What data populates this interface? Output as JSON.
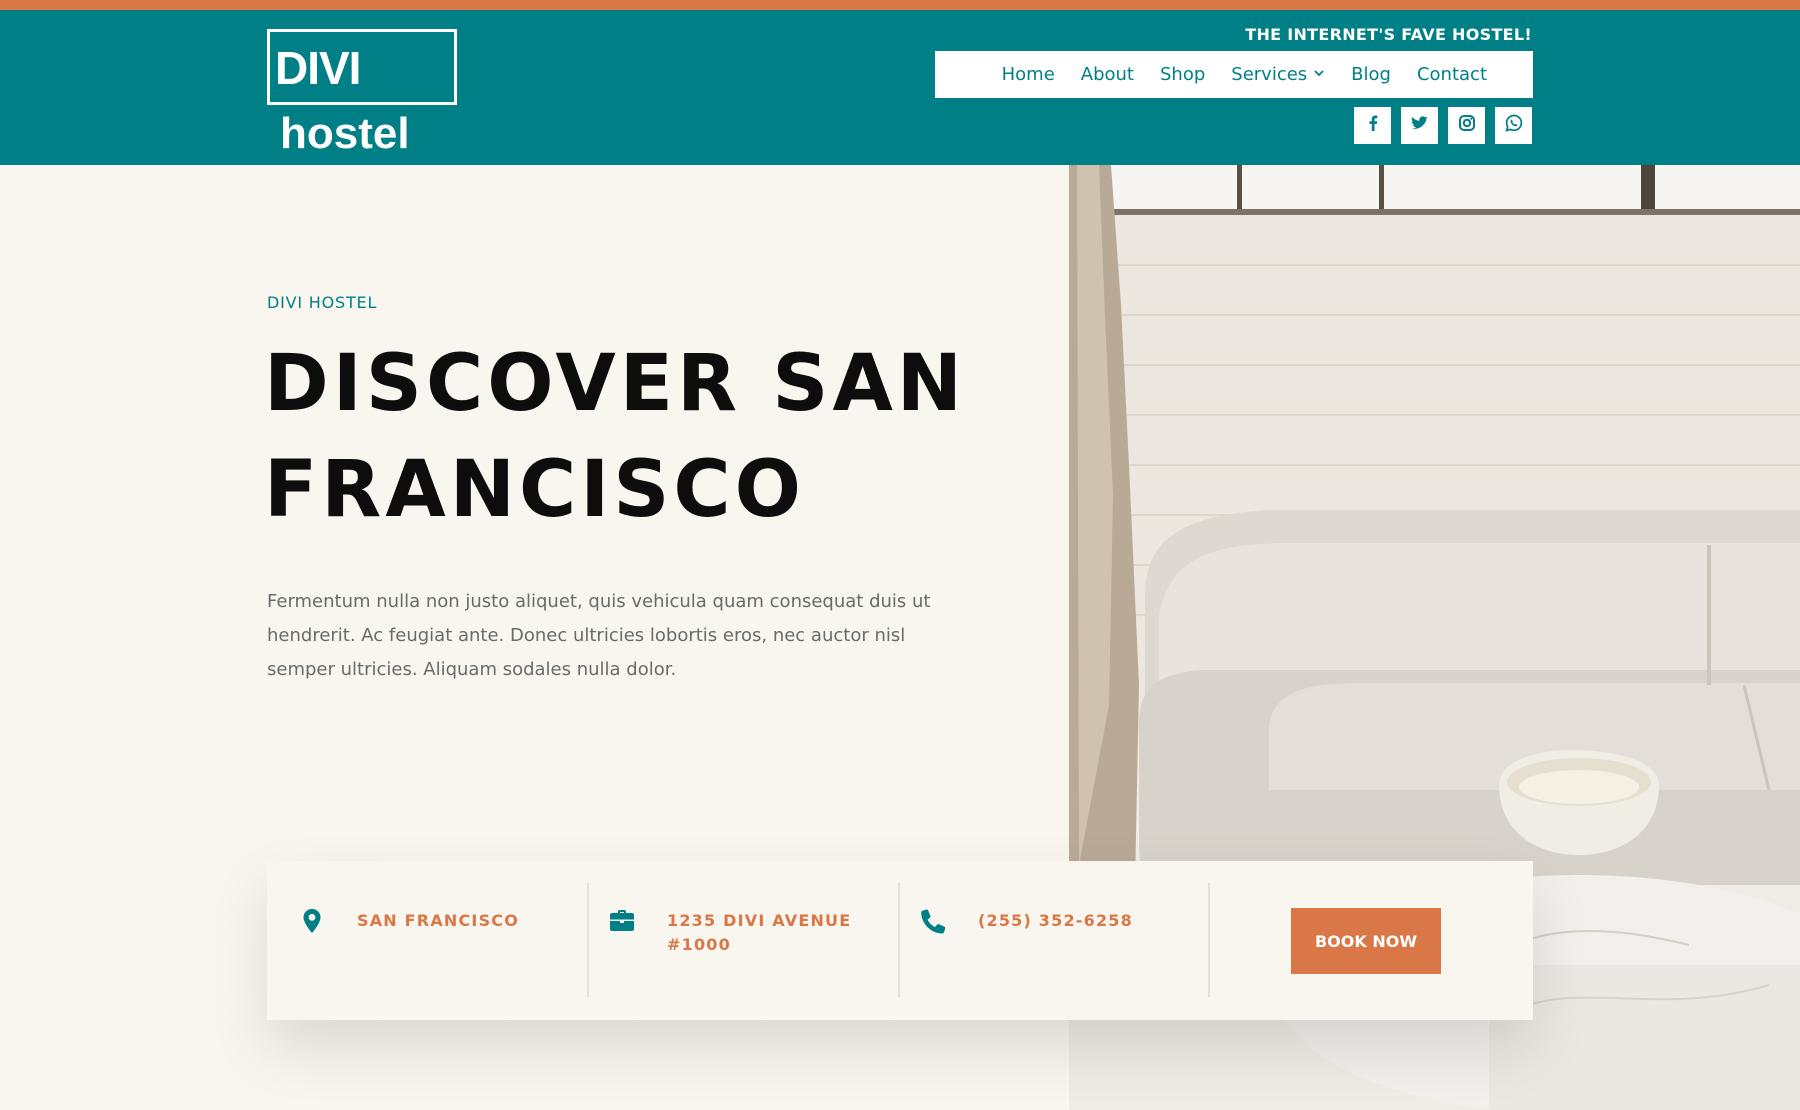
{
  "colors": {
    "teal": "#007f86",
    "orange": "#d97846",
    "cream": "#f9f6f0",
    "dark_text": "#0d0d0d",
    "body_text": "#6a6a6a"
  },
  "header": {
    "logo_top": "DIVI",
    "logo_bottom": "hostel",
    "tagline": "THE INTERNET'S FAVE HOSTEL!",
    "nav": [
      {
        "label": "Home"
      },
      {
        "label": "About"
      },
      {
        "label": "Shop"
      },
      {
        "label": "Services",
        "has_dropdown": true
      },
      {
        "label": "Blog"
      },
      {
        "label": "Contact"
      }
    ],
    "socials": [
      "facebook-icon",
      "twitter-icon",
      "instagram-icon",
      "whatsapp-icon"
    ]
  },
  "hero": {
    "eyebrow": "DIVI HOSTEL",
    "title_line1": "DISCOVER SAN",
    "title_line2": "FRANCISCO",
    "body": "Fermentum nulla non justo aliquet, quis vehicula quam consequat duis ut hendrerit. Ac feugiat ante. Donec ultricies lobortis eros, nec auctor nisl semper ultricies. Aliquam sodales nulla dolor."
  },
  "info_bar": {
    "items": [
      {
        "icon": "map-pin-icon",
        "line1": "SAN FRANCISCO",
        "line2": ""
      },
      {
        "icon": "briefcase-icon",
        "line1": "1235 DIVI AVENUE",
        "line2": "#1000"
      },
      {
        "icon": "phone-icon",
        "line1": "(255) 352-6258",
        "line2": ""
      }
    ],
    "cta_label": "BOOK NOW"
  }
}
